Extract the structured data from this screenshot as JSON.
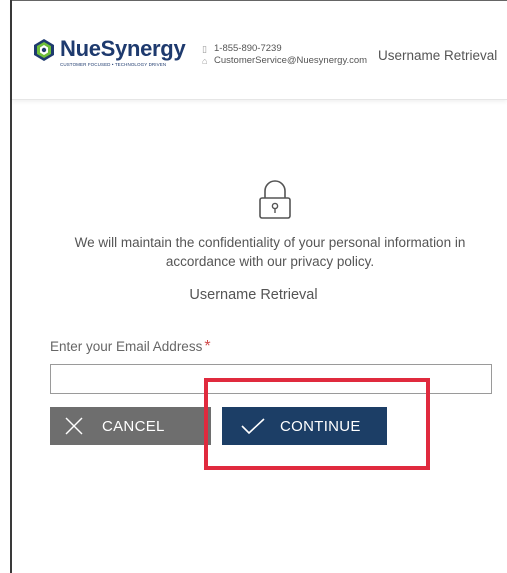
{
  "header": {
    "logo": {
      "name": "NueSynergy",
      "tagline": "CUSTOMER FOCUSED • TECHNOLOGY DRIVEN"
    },
    "contact": {
      "phone": "1-855-890-7239",
      "email": "CustomerService@Nuesynergy.com"
    },
    "title": "Username Retrieval"
  },
  "main": {
    "notice": "We will maintain the confidentiality of your personal information in accordance with our privacy policy.",
    "section_title": "Username Retrieval",
    "email_label": "Enter your Email Address",
    "required_marker": "*",
    "email_value": "",
    "cancel_label": "CANCEL",
    "continue_label": "CONTINUE"
  },
  "colors": {
    "brand_navy": "#1e3a6e",
    "continue_bg": "#1c3e66",
    "cancel_bg": "#6e6e6e",
    "required": "#d04a4a",
    "highlight": "#e02a3e"
  },
  "icons": [
    "lock-icon",
    "phone-icon",
    "mail-icon",
    "close-x-icon",
    "check-icon",
    "nuesynergy-logo-mark"
  ]
}
